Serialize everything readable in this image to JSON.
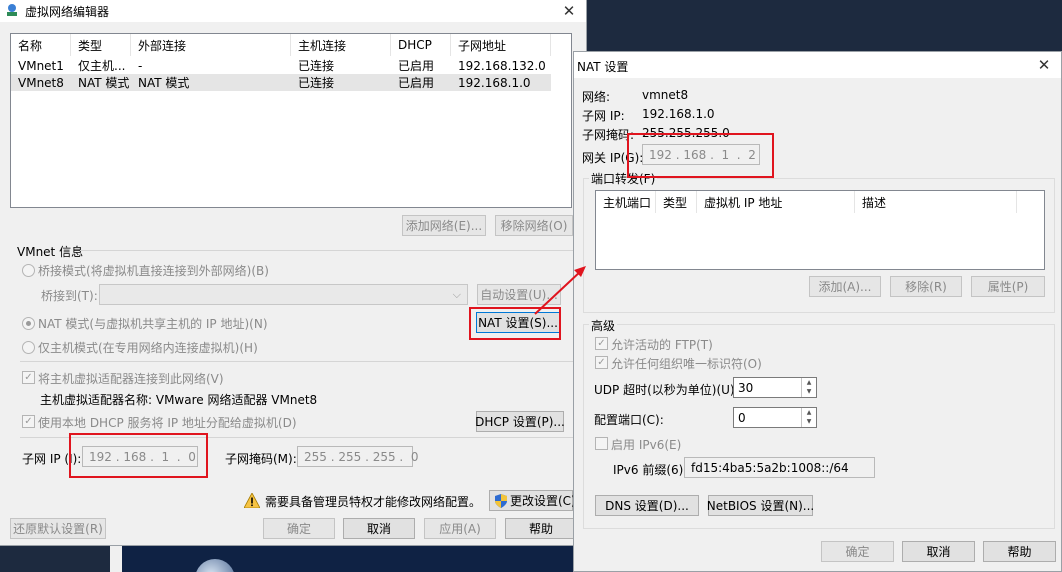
{
  "vne": {
    "title": "虚拟网络编辑器",
    "columns": [
      "名称",
      "类型",
      "外部连接",
      "主机连接",
      "DHCP",
      "子网地址"
    ],
    "rows": [
      [
        "VMnet1",
        "仅主机...",
        "-",
        "已连接",
        "已启用",
        "192.168.132.0"
      ],
      [
        "VMnet8",
        "NAT 模式",
        "NAT 模式",
        "已连接",
        "已启用",
        "192.168.1.0"
      ]
    ],
    "add_network": "添加网络(E)...",
    "remove_network": "移除网络(O)",
    "vmnet_info": "VMnet 信息",
    "bridged": "桥接模式(将虚拟机直接连接到外部网络)(B)",
    "bridged_to": "桥接到(T):",
    "auto_settings": "自动设置(U)...",
    "nat_mode": "NAT 模式(与虚拟机共享主机的 IP 地址)(N)",
    "nat_settings": "NAT 设置(S)...",
    "host_only": "仅主机模式(在专用网络内连接虚拟机)(H)",
    "connect_adapter": "将主机虚拟适配器连接到此网络(V)",
    "adapter_name": "主机虚拟适配器名称: VMware 网络适配器 VMnet8",
    "use_dhcp": "使用本地 DHCP 服务将 IP 地址分配给虚拟机(D)",
    "dhcp_settings": "DHCP 设置(P)...",
    "subnet_ip_label": "子网 IP (I):",
    "subnet_ip": "192 . 168 .  1  .  0",
    "subnet_mask_label": "子网掩码(M):",
    "subnet_mask": "255 . 255 . 255 .  0",
    "admin_notice": "需要具备管理员特权才能修改网络配置。",
    "change_settings": "更改设置(C)",
    "restore_defaults": "还原默认设置(R)",
    "ok": "确定",
    "cancel": "取消",
    "apply": "应用(A)",
    "help": "帮助"
  },
  "nat": {
    "title": "NAT 设置",
    "network_label": "网络:",
    "network_value": "vmnet8",
    "subnet_ip_label": "子网 IP:",
    "subnet_ip_value": "192.168.1.0",
    "subnet_mask_label": "子网掩码:",
    "subnet_mask_value": "255.255.255.0",
    "gateway_label": "网关 IP(G):",
    "gateway_value": "192 . 168 .  1  .  2",
    "port_forwarding": "端口转发(F)",
    "pf_columns": [
      "主机端口",
      "类型",
      "虚拟机 IP 地址",
      "描述"
    ],
    "add": "添加(A)...",
    "remove": "移除(R)",
    "properties": "属性(P)",
    "advanced": "高级",
    "allow_ftp": "允许活动的 FTP(T)",
    "allow_oui": "允许任何组织唯一标识符(O)",
    "udp_timeout_label": "UDP 超时(以秒为单位)(U):",
    "udp_timeout_value": "30",
    "config_port_label": "配置端口(C):",
    "config_port_value": "0",
    "enable_ipv6": "启用 IPv6(E)",
    "ipv6_prefix_label": "IPv6 前缀(6):",
    "ipv6_prefix_value": "fd15:4ba5:5a2b:1008::/64",
    "dns_settings": "DNS 设置(D)...",
    "netbios_settings": "NetBIOS 设置(N)...",
    "ok": "确定",
    "cancel": "取消",
    "help": "帮助"
  },
  "colors": {
    "highlight": "#e0141e",
    "window_bg": "#f0f0f0",
    "arrow": "#e0141e"
  }
}
